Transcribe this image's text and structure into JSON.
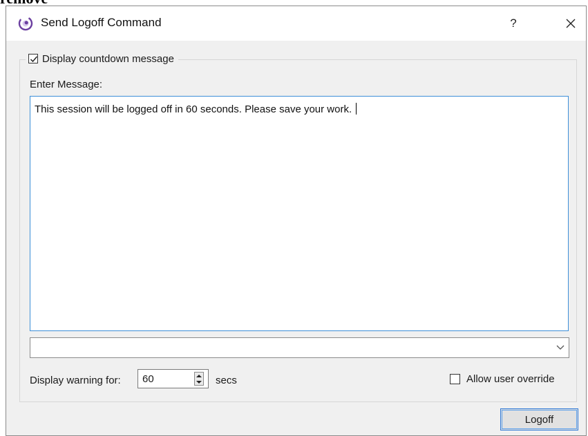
{
  "page_fragment": "remove",
  "window": {
    "title": "Send Logoff Command",
    "help_label": "?",
    "icons": {
      "app": "app-logo-icon",
      "close": "close-icon"
    }
  },
  "dialog": {
    "countdown_checkbox": {
      "label": "Display countdown message",
      "checked": true
    },
    "enter_message_label": "Enter Message:",
    "message_text": "This session will be logged off in 60 seconds. Please save your work.",
    "message_dropdown": {
      "value": ""
    },
    "display_warning_label": "Display warning for:",
    "warning_value": "60",
    "secs_label": "secs",
    "allow_override": {
      "label": "Allow user override",
      "checked": false
    },
    "logoff_button": "Logoff"
  },
  "colors": {
    "focus_border": "#3c8ed8",
    "button_accent": "#2f78d6",
    "app_icon": "#6b3fa0"
  }
}
